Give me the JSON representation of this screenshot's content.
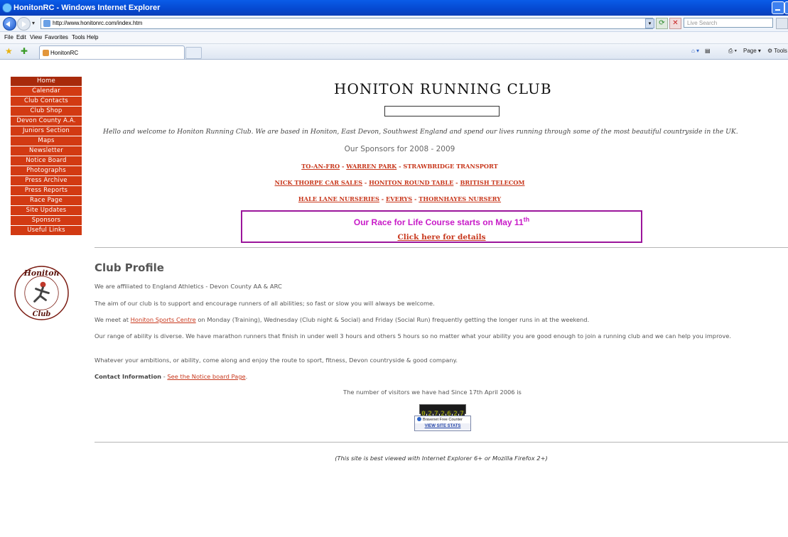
{
  "window": {
    "title": "HonitonRC - Windows Internet Explorer"
  },
  "addressbar": {
    "url": "http://www.honitonrc.com/index.htm",
    "search_placeholder": "Live Search"
  },
  "menubar": {
    "items": [
      "File",
      "Edit",
      "View",
      "Favorites",
      "Tools",
      "Help"
    ]
  },
  "tabs": {
    "active_tab": "HonitonRC",
    "commands": {
      "page": "Page",
      "tools": "Tools"
    }
  },
  "sidebar": {
    "items": [
      "Home",
      "Calendar",
      "Club Contacts",
      "Club Shop",
      "Devon County A.A.",
      "Juniors Section",
      "Maps",
      "Newsletter",
      "Notice Board",
      "Photographs",
      "Press Archive",
      "Press Reports",
      "Race Page",
      "Site Updates",
      "Sponsors",
      "Useful Links"
    ]
  },
  "header": {
    "title": "HONITON RUNNING CLUB"
  },
  "welcome_text": "Hello and welcome to Honiton Running Club. We are based in Honiton, East Devon, Southwest England and spend our lives running through some of the most beautiful countryside in the UK.",
  "sponsors": {
    "heading": "Our Sponsors for 2008 - 2009",
    "line1": [
      "TO-AN-FRO",
      "WARREN PARK",
      "STRAWBRIDGE TRANSPORT"
    ],
    "line2": [
      "NICK THORPE CAR SALES",
      "HONITON ROUND TABLE",
      "BRITISH TELECOM"
    ],
    "line3": [
      "HALE LANE NURSERIES",
      "EVERYS",
      "THORNHAYES NURSERY"
    ],
    "separator": " - "
  },
  "race_banner": {
    "title": "Our Race for Life Course starts on May 11",
    "superscript": "th",
    "link": "Click here for details"
  },
  "profile": {
    "title": "Club Profile",
    "p1": "We are affiliated to England Athletics - Devon County AA & ARC",
    "p2": "The aim of our club is to support and encourage runners of all abilities; so fast or slow you will always be welcome.",
    "p3_before": "We meet at ",
    "p3_link": "Honiton Sports Centre",
    "p3_after": " on Monday (Training), Wednesday (Club night & Social) and Friday (Social Run) frequently getting the longer runs in at the weekend.",
    "p4": "Our range of ability is diverse. We have marathon runners that finish in under well 3 hours and others 5 hours so no matter what your ability you are good enough to join a running club and we can help you improve.",
    "p5": "Whatever your ambitions, or ability, come along and enjoy the route to sport, fitness, Devon countryside & good company.",
    "contact_label": "Contact Information",
    "contact_sep": " - ",
    "contact_link": "See the Notice board Page",
    "contact_end": "."
  },
  "visitors": {
    "text": "The number of visitors we have had Since 17th April 2006 is",
    "digits": [
      "0",
      "2",
      "7",
      "2",
      "6",
      "2",
      "7"
    ],
    "badge_top": "Bravenet Free Counter",
    "badge_link": "VIEW SITE STATS"
  },
  "footer": {
    "best_viewed": "(This site is best viewed with Internet Explorer 6+ or Mozilla Firefox 2+)"
  },
  "logo_text": "Honiton Running Club"
}
